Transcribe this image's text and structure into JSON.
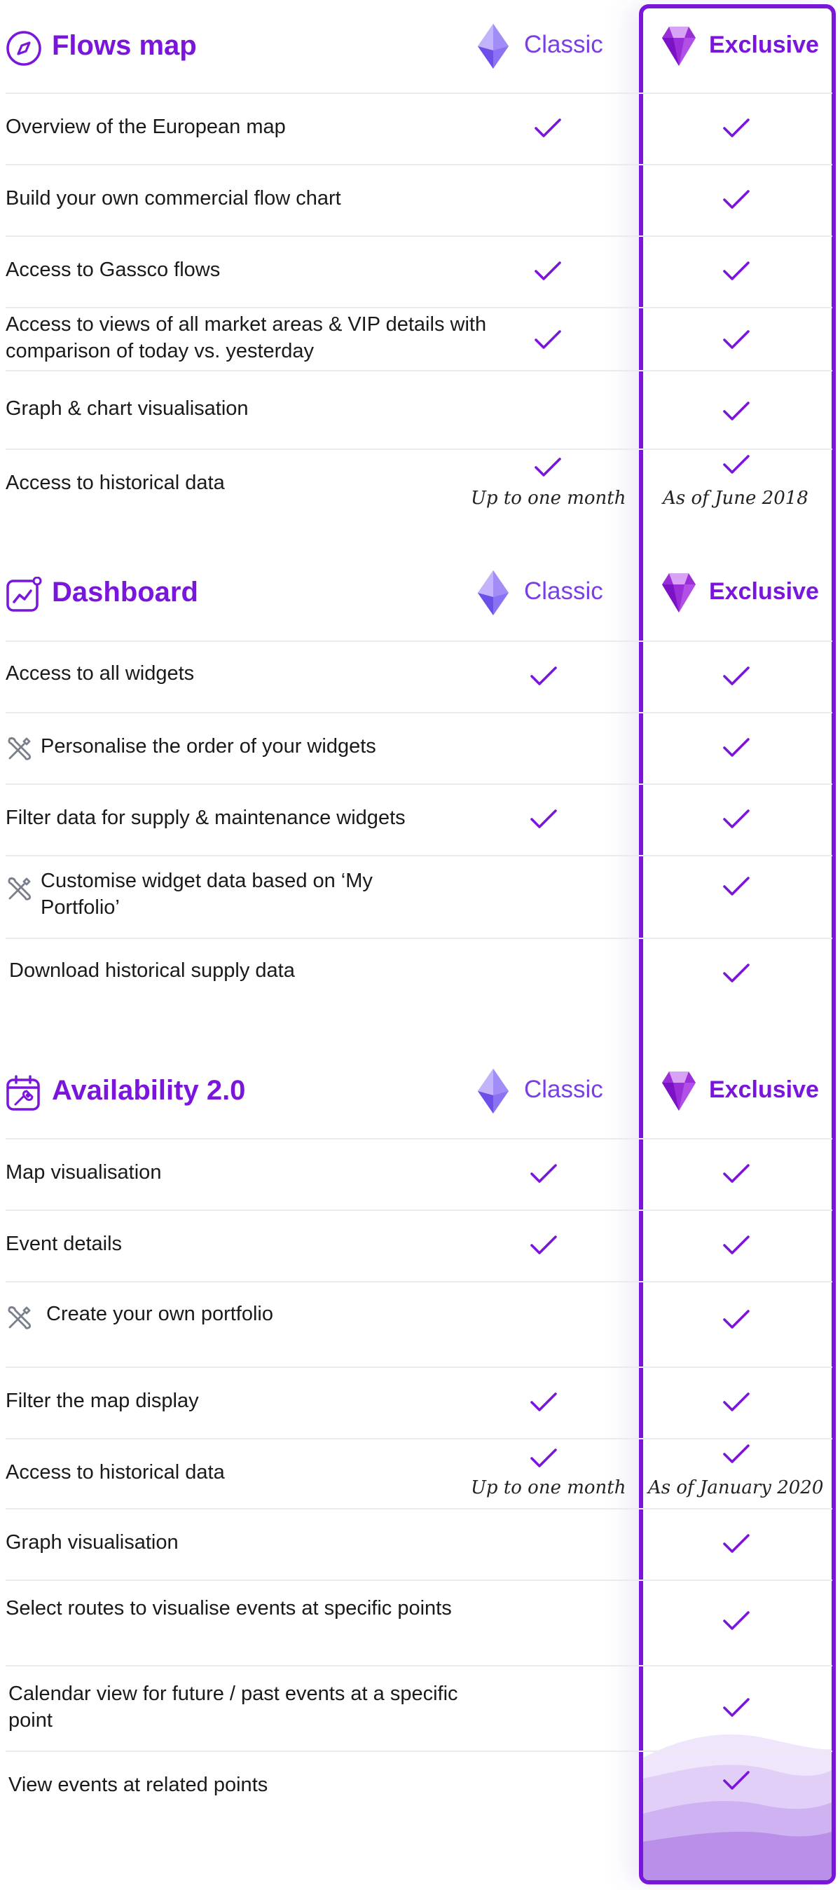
{
  "colors": {
    "accent": "#7a16dc",
    "classic_label": "#7a3fe4",
    "divider": "#ebebef",
    "tool_icon": "#7a7f8c"
  },
  "plans": {
    "classic": "Classic",
    "exclusive": "Exclusive"
  },
  "sections": [
    {
      "title": "Flows map",
      "icon": "compass-icon",
      "rows": [
        {
          "label": "Overview of the European map",
          "classic": true,
          "exclusive": true
        },
        {
          "label": "Build your own commercial flow chart",
          "classic": false,
          "exclusive": true
        },
        {
          "label": "Access to Gassco flows",
          "classic": true,
          "exclusive": true
        },
        {
          "label": "Access to views of all market areas & VIP details with comparison of today vs. yesterday",
          "classic": true,
          "exclusive": true
        },
        {
          "label": "Graph & chart visualisation",
          "classic": false,
          "exclusive": true
        },
        {
          "label": "Access to historical data",
          "classic": true,
          "exclusive": true,
          "classic_note": "Up to one month",
          "exclusive_note": "As of June 2018"
        }
      ]
    },
    {
      "title": "Dashboard",
      "icon": "chart-line-icon",
      "rows": [
        {
          "label": "Access to all widgets",
          "classic": true,
          "exclusive": true
        },
        {
          "label": "Personalise the order of your widgets",
          "classic": false,
          "exclusive": true,
          "tool_icon": "wrench-screwdriver-icon"
        },
        {
          "label": "Filter data for supply & maintenance widgets",
          "classic": true,
          "exclusive": true
        },
        {
          "label": "Customise widget data based on ‘My Portfolio’",
          "classic": false,
          "exclusive": true,
          "tool_icon": "wrench-screwdriver-icon"
        },
        {
          "label": "Download historical supply data",
          "classic": false,
          "exclusive": true
        }
      ]
    },
    {
      "title": "Availability 2.0",
      "icon": "calendar-wrench-icon",
      "rows": [
        {
          "label": "Map visualisation",
          "classic": true,
          "exclusive": true
        },
        {
          "label": "Event details",
          "classic": true,
          "exclusive": true
        },
        {
          "label": "Create your own portfolio",
          "classic": false,
          "exclusive": true,
          "tool_icon": "wrench-screwdriver-icon"
        },
        {
          "label": "Filter the map display",
          "classic": true,
          "exclusive": true
        },
        {
          "label": "Access to historical data",
          "classic": true,
          "exclusive": true,
          "classic_note": "Up to one month",
          "exclusive_note": "As of January 2020"
        },
        {
          "label": "Graph visualisation",
          "classic": false,
          "exclusive": true
        },
        {
          "label": "Select routes to visualise events at specific points",
          "classic": false,
          "exclusive": true
        },
        {
          "label": "Calendar view for future / past events at a specific point",
          "classic": false,
          "exclusive": true
        },
        {
          "label": "View events at related points",
          "classic": false,
          "exclusive": true
        }
      ]
    }
  ]
}
